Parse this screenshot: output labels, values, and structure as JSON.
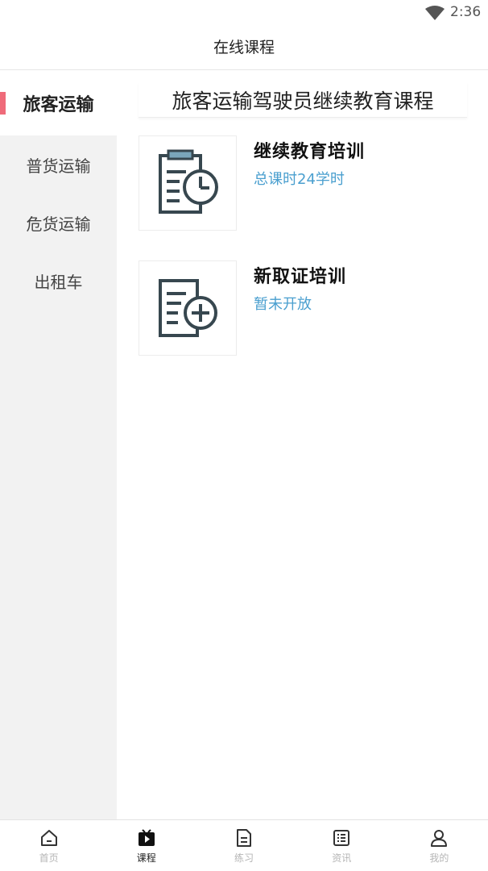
{
  "status_bar": {
    "time": "2:36"
  },
  "header": {
    "title": "在线课程"
  },
  "sidebar": {
    "items": [
      {
        "label": "旅客运输",
        "active": true
      },
      {
        "label": "普货运输",
        "active": false
      },
      {
        "label": "危货运输",
        "active": false
      },
      {
        "label": "出租车",
        "active": false
      }
    ]
  },
  "content": {
    "title": "旅客运输驾驶员继续教育课程",
    "courses": [
      {
        "name": "继续教育培训",
        "subtitle": "总课时24学时",
        "icon": "clipboard-clock-icon"
      },
      {
        "name": "新取证培训",
        "subtitle": "暂未开放",
        "icon": "document-plus-icon"
      }
    ]
  },
  "tabbar": {
    "tabs": [
      {
        "label": "首页",
        "icon": "home-icon",
        "active": false
      },
      {
        "label": "课程",
        "icon": "play-video-icon",
        "active": true
      },
      {
        "label": "练习",
        "icon": "document-icon",
        "active": false
      },
      {
        "label": "资讯",
        "icon": "list-icon",
        "active": false
      },
      {
        "label": "我的",
        "icon": "user-icon",
        "active": false
      }
    ]
  },
  "colors": {
    "accent_indicator": "#ef6b7a",
    "subtitle_blue": "#4a9fcf",
    "icon_dark": "#37474f",
    "icon_light": "#7aa6bb"
  }
}
